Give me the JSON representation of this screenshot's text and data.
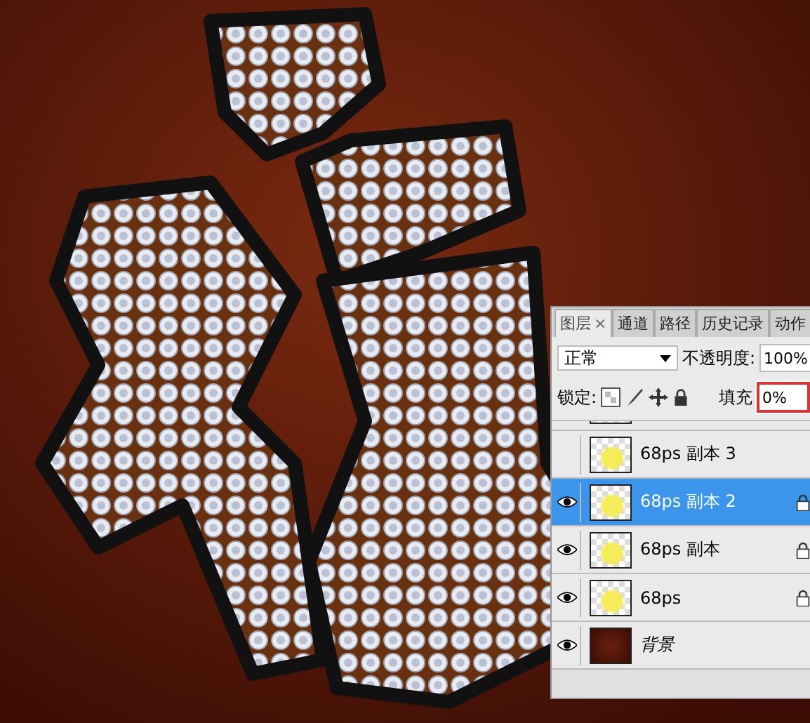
{
  "tabs": [
    {
      "label": "图层",
      "selected": true,
      "close": "×"
    },
    {
      "label": "通道",
      "selected": false
    },
    {
      "label": "路径",
      "selected": false
    },
    {
      "label": "历史记录",
      "selected": false
    },
    {
      "label": "动作",
      "selected": false
    }
  ],
  "blend_mode": "正常",
  "opacity": {
    "label": "不透明度:",
    "value": "100%"
  },
  "lock": {
    "label": "锁定:"
  },
  "fill": {
    "label": "填充",
    "value": "0%",
    "highlighted": true
  },
  "layers": [
    {
      "name": "68ps 副本 3",
      "kind": "pixels",
      "visible": false,
      "selected": false,
      "locked": false,
      "italic": false
    },
    {
      "name": "68ps 副本 2",
      "kind": "pixels",
      "visible": true,
      "selected": true,
      "locked": true,
      "italic": false
    },
    {
      "name": "68ps 副本",
      "kind": "pixels",
      "visible": true,
      "selected": false,
      "locked": true,
      "italic": false
    },
    {
      "name": "68ps",
      "kind": "pixels",
      "visible": true,
      "selected": false,
      "locked": true,
      "italic": false
    },
    {
      "name": "背景",
      "kind": "fill",
      "visible": true,
      "selected": false,
      "locked": false,
      "italic": true
    }
  ]
}
